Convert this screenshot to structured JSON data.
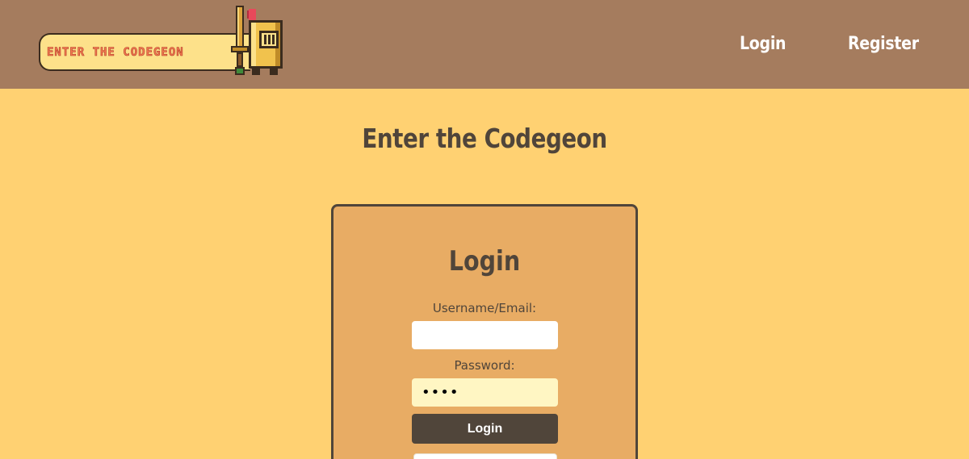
{
  "navbar": {
    "logo_text": "Enter the Codegeon",
    "links": [
      {
        "label": "Login"
      },
      {
        "label": "Register"
      }
    ]
  },
  "page": {
    "title": "Enter the Codegeon"
  },
  "login_form": {
    "title": "Login",
    "username_label": "Username/Email:",
    "username_value": "",
    "password_label": "Password:",
    "password_value": "••••",
    "submit_label": "Login"
  },
  "colors": {
    "background": "#ffd172",
    "navbar": "#a57c5e",
    "card": "#e8ac64",
    "text_dark": "#50453a",
    "password_field": "#fff6c3",
    "logo_text": "#f37b51"
  },
  "icons": {
    "logo": "knight-with-sword-icon"
  }
}
